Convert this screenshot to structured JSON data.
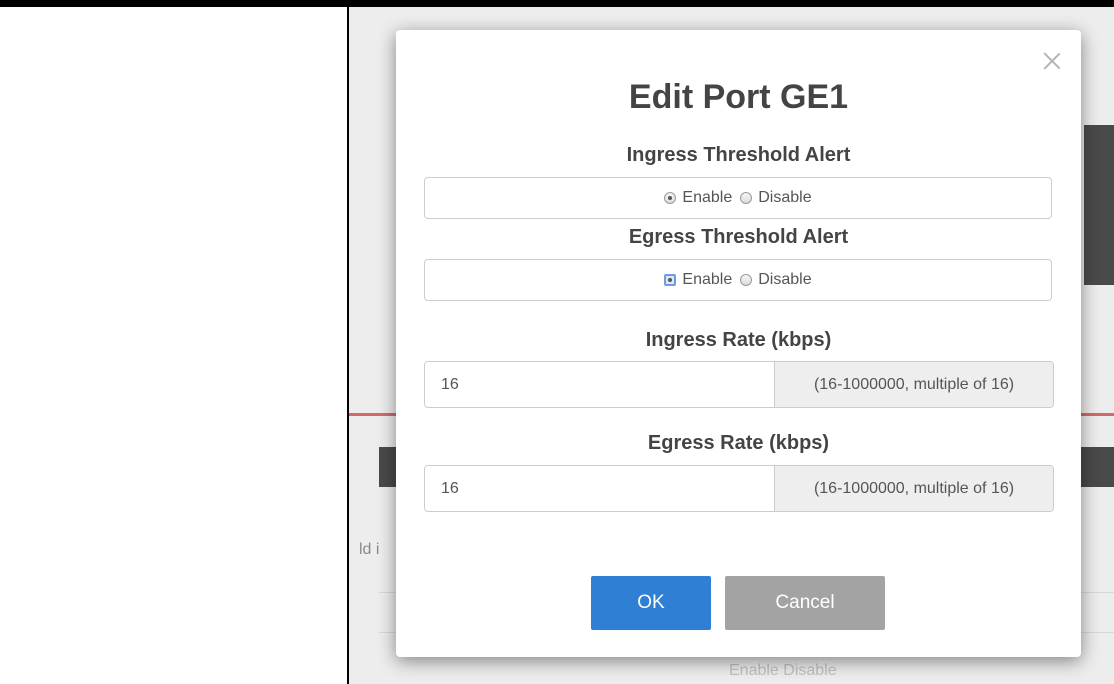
{
  "modal": {
    "title": "Edit Port GE1",
    "ingress_alert": {
      "label": "Ingress Threshold Alert",
      "enable_label": "Enable",
      "disable_label": "Disable",
      "selected": "Enable"
    },
    "egress_alert": {
      "label": "Egress Threshold Alert",
      "enable_label": "Enable",
      "disable_label": "Disable",
      "selected": "Enable"
    },
    "ingress_rate": {
      "label": "Ingress Rate (kbps)",
      "value": "16",
      "hint": "(16-1000000, multiple of 16)"
    },
    "egress_rate": {
      "label": "Egress Rate (kbps)",
      "value": "16",
      "hint": "(16-1000000, multiple of 16)"
    },
    "ok_label": "OK",
    "cancel_label": "Cancel"
  },
  "background": {
    "partial_text_1": "ld i",
    "partial_text_2": "Enable  Disable"
  },
  "colors": {
    "primary_button": "#2f7fd4",
    "cancel_button": "#a3a3a3",
    "addon_bg": "#eeeeee",
    "text": "#444444"
  }
}
